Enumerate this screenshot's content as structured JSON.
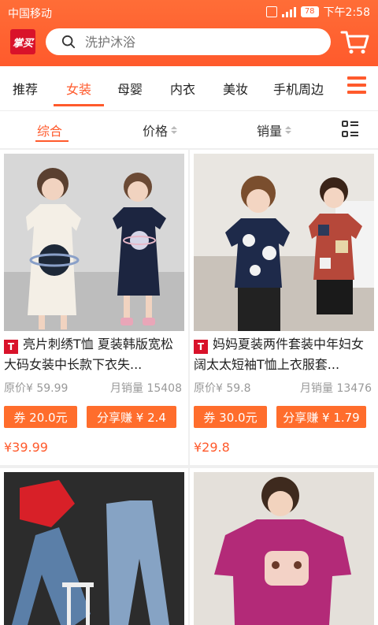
{
  "status_bar": {
    "carrier": "中国移动",
    "battery": "78",
    "time": "下午2:58"
  },
  "header": {
    "logo_text": "掌买",
    "search_placeholder": "洗护沐浴"
  },
  "categories": [
    {
      "label": "推荐",
      "active": false
    },
    {
      "label": "女装",
      "active": true
    },
    {
      "label": "母婴",
      "active": false
    },
    {
      "label": "内衣",
      "active": false
    },
    {
      "label": "美妆",
      "active": false
    },
    {
      "label": "手机周边",
      "active": false
    }
  ],
  "sort": {
    "comprehensive": "综合",
    "price": "价格",
    "sales": "销量"
  },
  "products": [
    {
      "badge": "T",
      "title": "亮片刺绣T恤 夏装韩版宽松大码女装中长款下衣失...",
      "original_price": "原价¥ 59.99",
      "monthly_sales": "月销量 15408",
      "coupon": "券 20.0元",
      "share": "分享赚 ¥ 2.4",
      "price": "¥39.99"
    },
    {
      "badge": "T",
      "title": "妈妈夏装两件套装中年妇女阔太太短袖T恤上衣服套...",
      "original_price": "原价¥ 59.8",
      "monthly_sales": "月销量 13476",
      "coupon": "券 30.0元",
      "share": "分享赚 ¥ 1.79",
      "price": "¥29.8"
    }
  ],
  "colors": {
    "accent": "#ff5a2c",
    "tmall_red": "#d9122a"
  },
  "icons": [
    "search-icon",
    "cart-icon",
    "menu-icon",
    "grid-list-icon"
  ]
}
